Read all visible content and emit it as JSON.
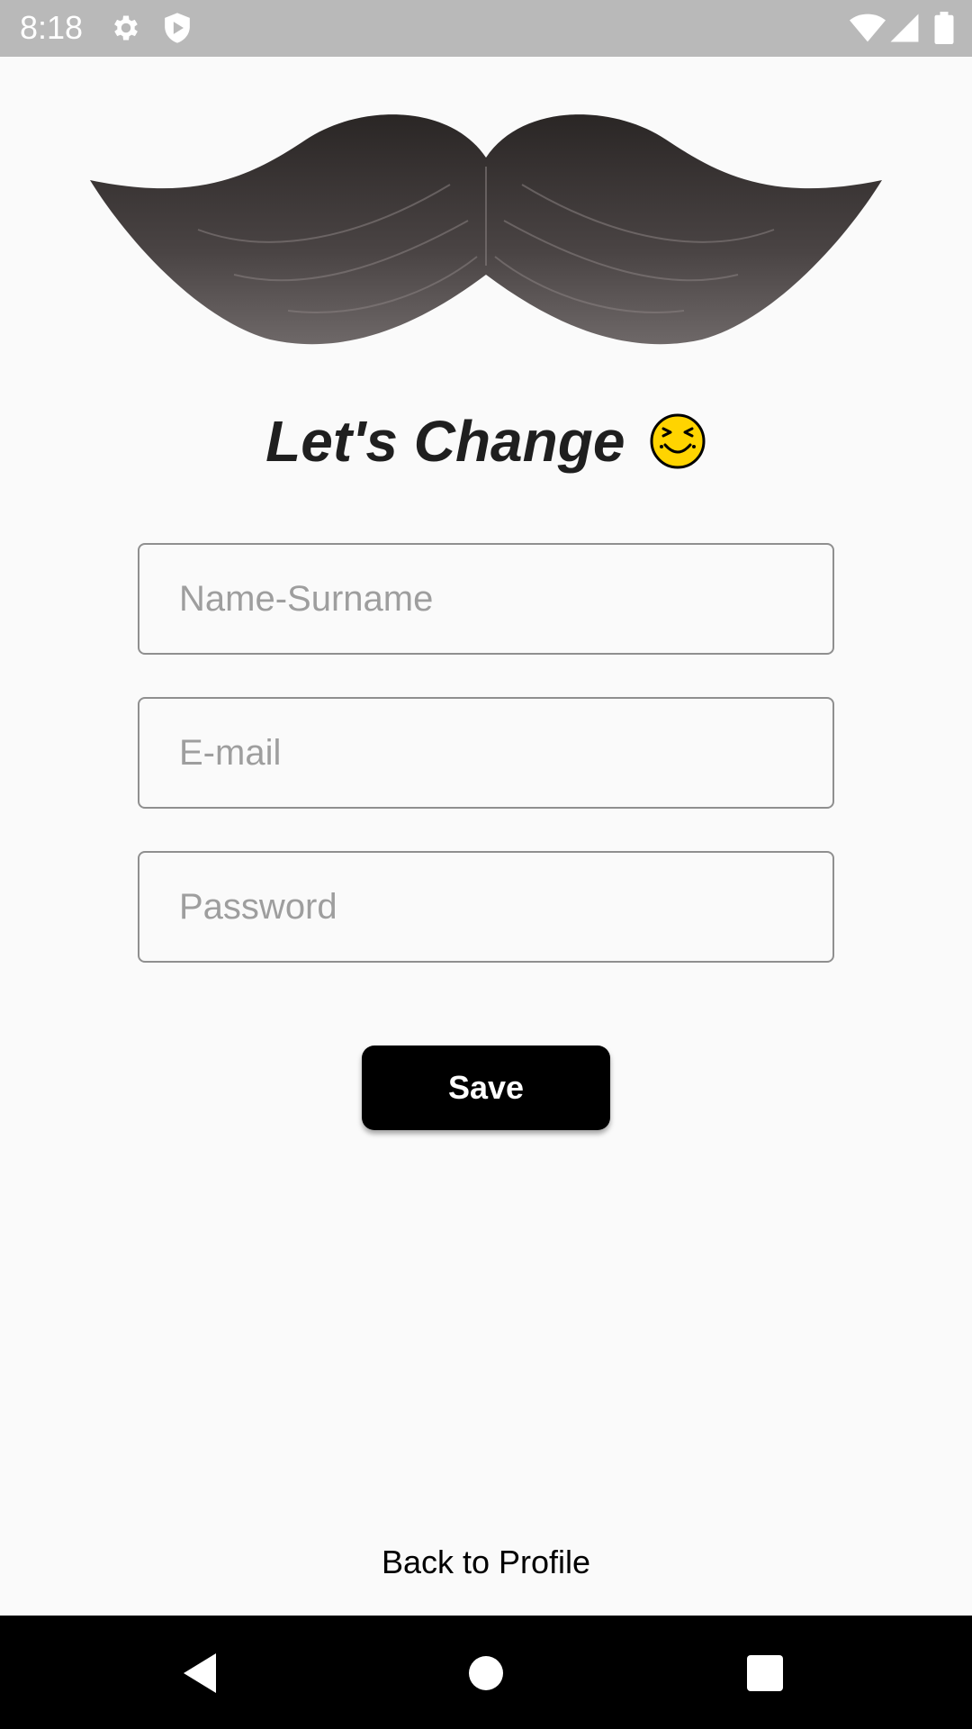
{
  "status_bar": {
    "time": "8:18",
    "icons": [
      "gear-icon",
      "shield-icon",
      "wifi-icon",
      "signal-icon",
      "battery-icon"
    ]
  },
  "header": {
    "title": "Let's Change",
    "emoji": "laughing-smiley-icon"
  },
  "form": {
    "name_placeholder": "Name-Surname",
    "email_placeholder": "E-mail",
    "password_placeholder": "Password",
    "name_value": "",
    "email_value": "",
    "password_value": ""
  },
  "actions": {
    "save_label": "Save",
    "back_label": "Back to Profile"
  },
  "nav_bar": {
    "buttons": [
      "back-triangle-icon",
      "home-circle-icon",
      "recents-square-icon"
    ]
  },
  "colors": {
    "background": "#fafafa",
    "status_bar": "#b9b9b9",
    "button": "#000000",
    "button_text": "#ffffff",
    "field_border": "#8f8f8f",
    "placeholder": "#9e9e9e",
    "emoji": "#ffd400"
  }
}
